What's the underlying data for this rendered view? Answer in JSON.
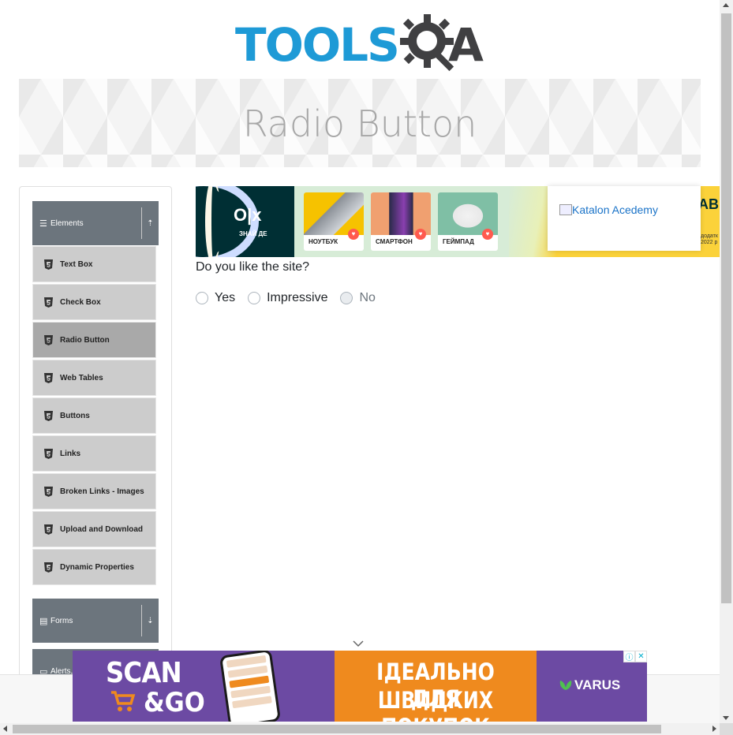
{
  "logo": {
    "text_main": "TOOLS",
    "text_end": "A",
    "icon": "gear-magnifier-icon",
    "brand_blue": "#1e9ad6",
    "brand_dark": "#404042"
  },
  "banner": {
    "title": "Radio Button"
  },
  "sidebar": {
    "groups": [
      {
        "label": "Elements",
        "icon": "hamburger-icon",
        "toggle_icon": "arrow-up-icon"
      },
      {
        "label": "Forms",
        "icon": "document-icon",
        "toggle_icon": "arrow-down-icon"
      },
      {
        "label": "Alerts,",
        "icon": "window-icon"
      }
    ],
    "items": [
      {
        "label": "Text Box",
        "active": false
      },
      {
        "label": "Check Box",
        "active": false
      },
      {
        "label": "Radio Button",
        "active": true
      },
      {
        "label": "Web Tables",
        "active": false
      },
      {
        "label": "Buttons",
        "active": false
      },
      {
        "label": "Links",
        "active": false
      },
      {
        "label": "Broken Links - Images",
        "active": false
      },
      {
        "label": "Upload and Download",
        "active": false
      },
      {
        "label": "Dynamic Properties",
        "active": false
      }
    ],
    "item_icon": "html5-icon"
  },
  "ad_top": {
    "brand": "O|x",
    "tagline": "ЗНАЙ ДЕ",
    "products": [
      "НОУТБУК",
      "СМАРТФОН",
      "ГЕЙМПАД"
    ],
    "right_text": "AB",
    "right_small_1": "додатк",
    "right_small_2": "2022 р",
    "right_small_3": "п"
  },
  "katalon": {
    "alt_text": "Katalon Acedemy"
  },
  "form": {
    "question": "Do you like the site?",
    "options": [
      {
        "label": "Yes",
        "disabled": false,
        "checked": false
      },
      {
        "label": "Impressive",
        "disabled": false,
        "checked": false
      },
      {
        "label": "No",
        "disabled": true,
        "checked": false
      }
    ]
  },
  "ad_bottom": {
    "left_title": "SCAN",
    "left_sub": "&GO",
    "middle_line1": "ІДЕАЛЬНО ДЛЯ",
    "middle_line2": "ШВИДКИХ ПОКУПОК",
    "brand": "VARUS",
    "info_icon": "info-icon",
    "close_icon": "close-icon"
  },
  "colors": {
    "sidebar_header": "#6c757d",
    "menu_item": "#cccccc",
    "menu_item_active": "#a9a9a9",
    "ad_purple": "#6c4aa3",
    "ad_orange": "#ef8a1e"
  }
}
